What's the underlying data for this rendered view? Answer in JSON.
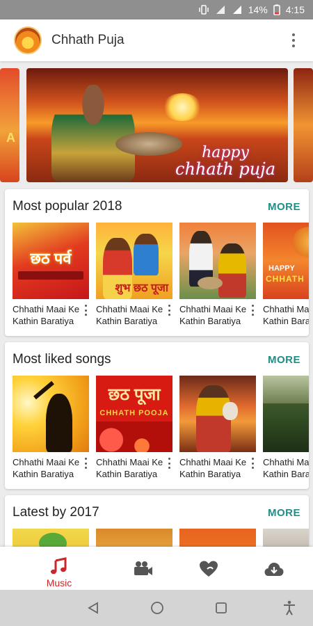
{
  "status_bar": {
    "battery_percent": "14%",
    "time": "4:15",
    "icons": [
      "vibrate-icon",
      "signal-data-icon",
      "signal-icon",
      "battery-low-icon"
    ]
  },
  "app_bar": {
    "title": "Chhath Puja",
    "logo_icon": "app-logo-icon",
    "menu_icon": "more-vertical-icon"
  },
  "banner": {
    "slides": [
      {
        "text": "A"
      },
      {
        "line1": "happy",
        "line2": "chhath puja"
      },
      {
        "text": ""
      }
    ]
  },
  "sections": [
    {
      "title": "Most popular 2018",
      "more_label": "MORE",
      "items": [
        {
          "line1": "Chhathi Maai Ke",
          "line2": "Kathin Baratiya",
          "thumb_text": "छठ पर्व"
        },
        {
          "line1": "Chhathi Maai Ke",
          "line2": "Kathin Baratiya",
          "thumb_text": "शुभ छठ पूजा"
        },
        {
          "line1": "Chhathi Maai Ke",
          "line2": "Kathin Baratiya",
          "thumb_text": ""
        },
        {
          "line1": "Chhathi Ma",
          "line2": "Kathin Bara",
          "thumb_text": "HAPPY",
          "thumb_text2": "CHHATH"
        }
      ]
    },
    {
      "title": "Most liked songs",
      "more_label": "MORE",
      "items": [
        {
          "line1": "Chhathi Maai Ke",
          "line2": "Kathin Baratiya",
          "thumb_text": ""
        },
        {
          "line1": "Chhathi Maai Ke",
          "line2": "Kathin Baratiya",
          "thumb_text": "छठ पूजा",
          "thumb_text2": "CHHATH POOJA"
        },
        {
          "line1": "Chhathi Maai Ke",
          "line2": "Kathin Baratiya",
          "thumb_text": ""
        },
        {
          "line1": "Chhathi Ma",
          "line2": "Kathin Bara",
          "thumb_text": ""
        }
      ]
    },
    {
      "title": "Latest by 2017",
      "more_label": "MORE"
    }
  ],
  "bottom_nav": {
    "items": [
      {
        "label": "Music",
        "icon": "music-note-icon",
        "active": true
      },
      {
        "label": "",
        "icon": "video-camera-icon",
        "active": false
      },
      {
        "label": "",
        "icon": "favorites-hearts-icon",
        "active": false
      },
      {
        "label": "",
        "icon": "cloud-download-icon",
        "active": false
      }
    ]
  },
  "system_nav": {
    "icons": [
      "back-icon",
      "home-icon",
      "recents-icon",
      "accessibility-icon"
    ]
  },
  "colors": {
    "accent": "#1e8e86",
    "active_nav": "#c8272c",
    "status_bar": "#8f8f8f"
  }
}
